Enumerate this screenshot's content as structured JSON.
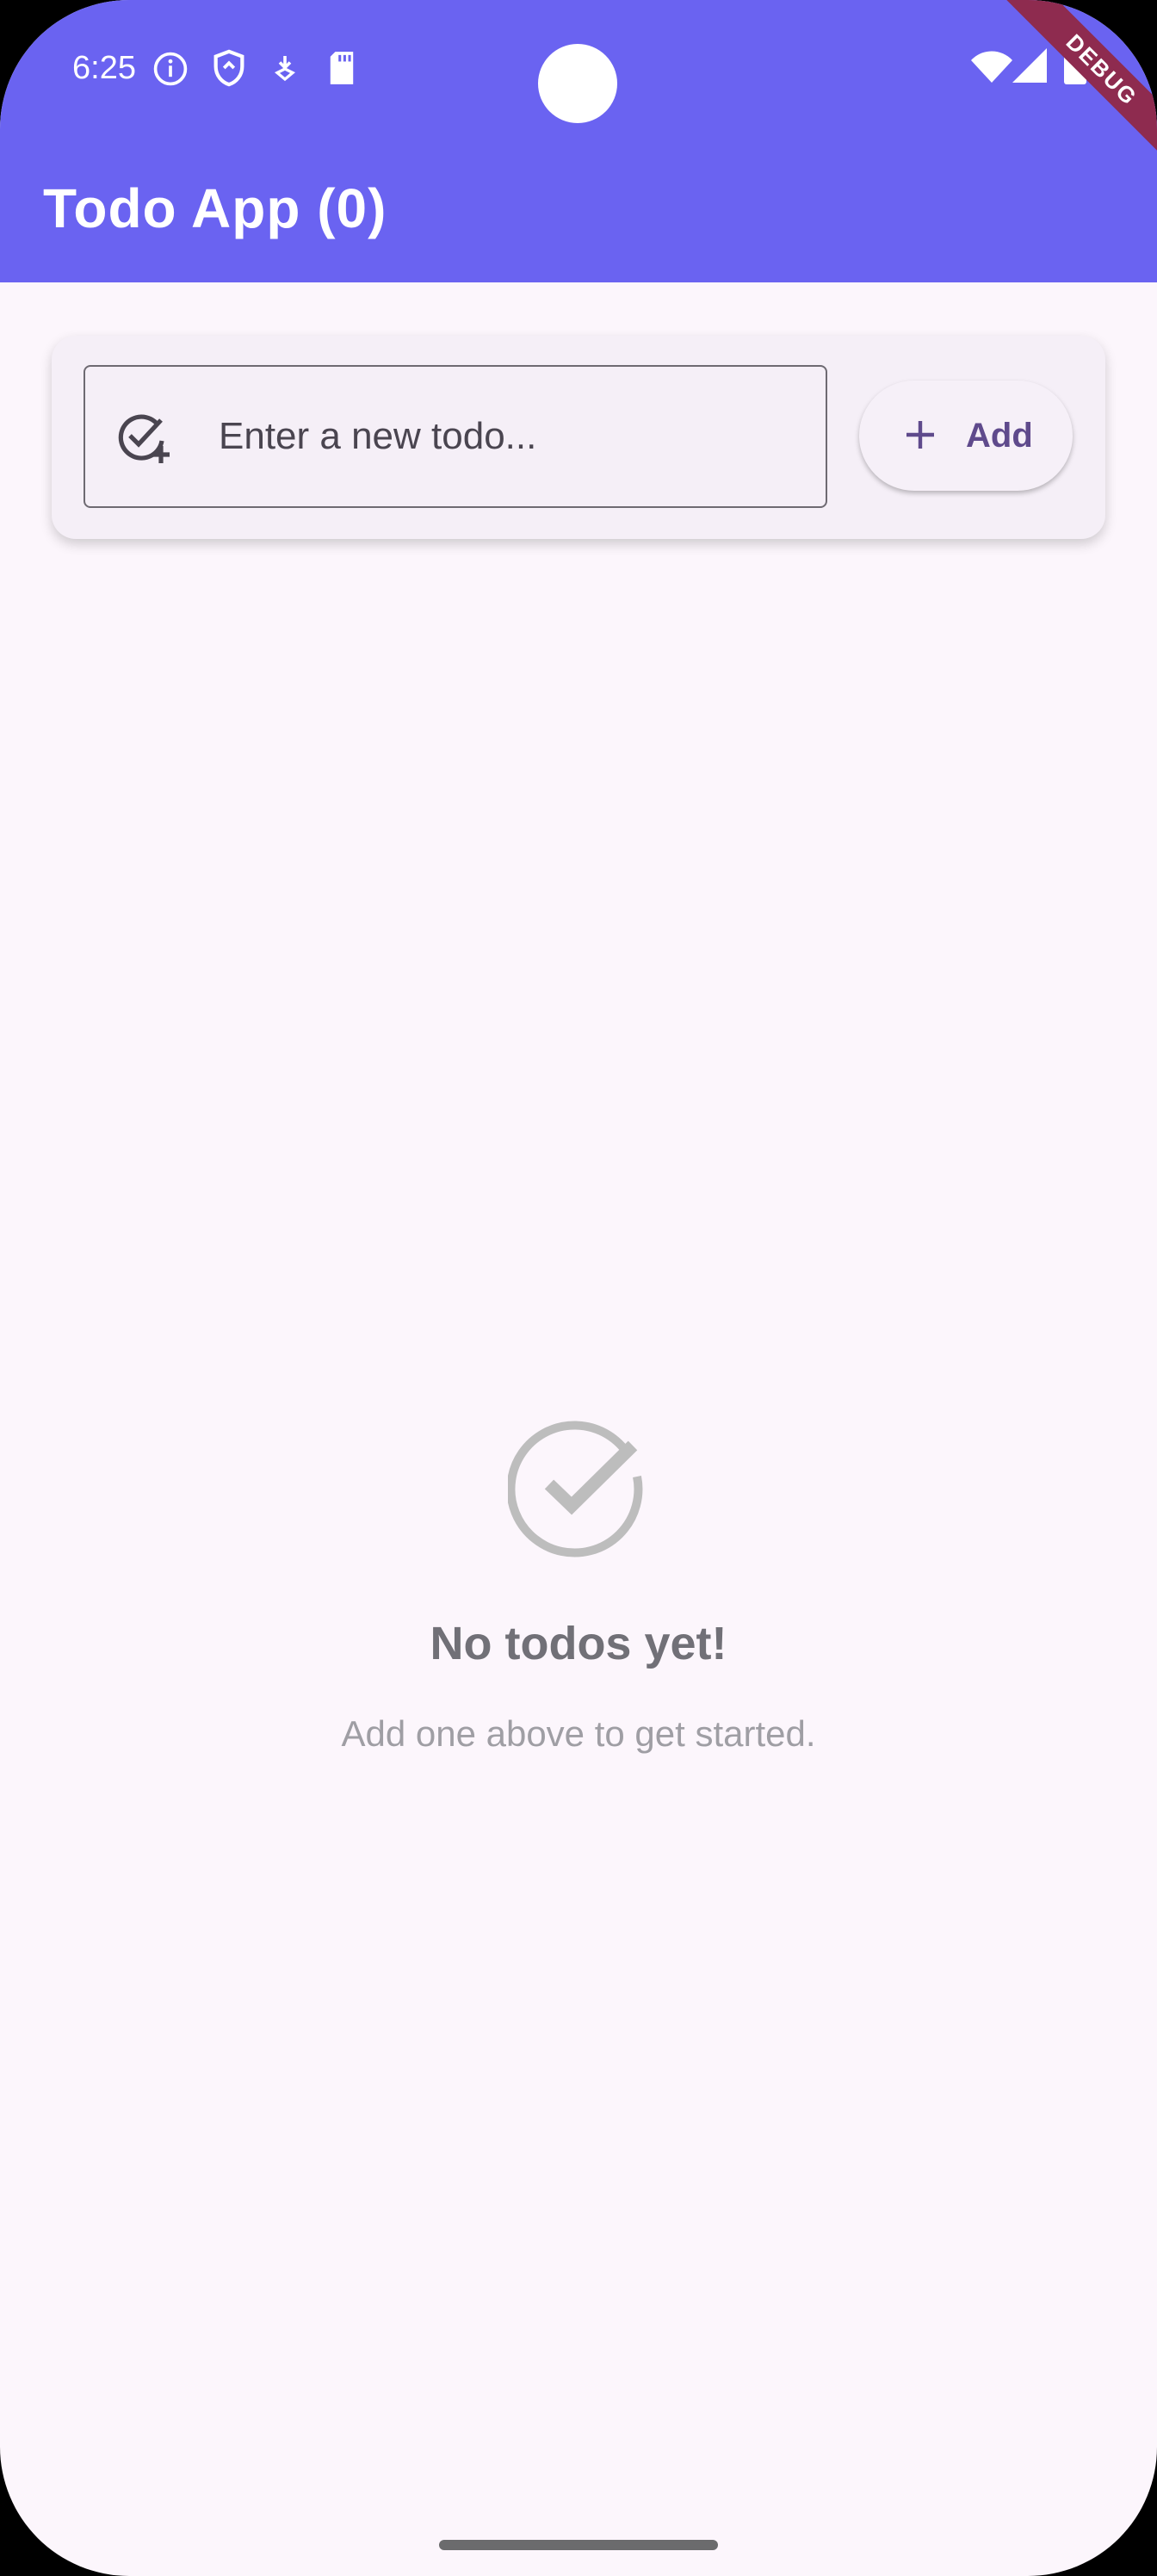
{
  "status_bar": {
    "time": "6:25",
    "left_icons": [
      "info-icon",
      "shield-icon",
      "download-icon",
      "sd-card-icon"
    ],
    "right_icons": [
      "wifi-icon",
      "signal-icon",
      "battery-icon"
    ]
  },
  "debug_banner": {
    "label": "DEBUG"
  },
  "app_bar": {
    "title": "Todo App (0)"
  },
  "add_card": {
    "input": {
      "placeholder": "Enter a new todo...",
      "value": "",
      "icon": "add-task-icon"
    },
    "add_button": {
      "label": "Add",
      "icon": "plus-icon"
    }
  },
  "empty_state": {
    "icon": "check-circle-icon",
    "title": "No todos yet!",
    "subtitle": "Add one above to get started."
  },
  "colors": {
    "app_bar": "#6a63f1",
    "background": "#fcf6fc",
    "card": "#f5eff7",
    "accent": "#5f4a8c",
    "empty_icon": "#bdbdbd",
    "debug_banner": "#8e2b4f"
  }
}
